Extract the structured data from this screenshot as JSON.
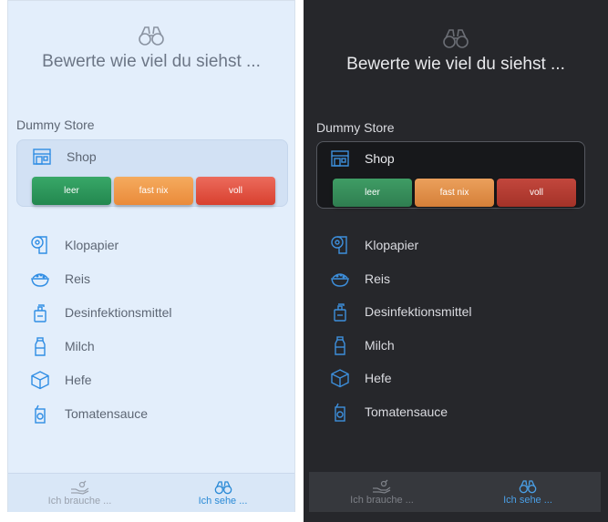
{
  "header": {
    "title": "Bewerte wie viel du siehst ...",
    "icon": "binoculars-icon"
  },
  "store": {
    "name": "Dummy Store"
  },
  "shop": {
    "label": "Shop",
    "icon": "storefront-icon",
    "ratings": [
      {
        "label": "leer",
        "color": "#2a9a5c"
      },
      {
        "label": "fast nix",
        "color": "#f09b4b"
      },
      {
        "label": "voll",
        "color": "#e04c3c"
      }
    ]
  },
  "items": [
    {
      "label": "Klopapier",
      "icon": "toilet-paper-icon"
    },
    {
      "label": "Reis",
      "icon": "rice-bowl-icon"
    },
    {
      "label": "Desinfektionsmittel",
      "icon": "disinfectant-icon"
    },
    {
      "label": "Milch",
      "icon": "milk-bottle-icon"
    },
    {
      "label": "Hefe",
      "icon": "yeast-cube-icon"
    },
    {
      "label": "Tomatensauce",
      "icon": "tomato-sauce-icon"
    }
  ],
  "tabs": [
    {
      "label": "Ich brauche ...",
      "icon": "hand-need-icon",
      "active": false
    },
    {
      "label": "Ich sehe ...",
      "icon": "binoculars-icon",
      "active": true
    }
  ],
  "colors": {
    "accent_light": "#2a8ad6",
    "accent_dark": "#4a9fe6",
    "icon_blue": "#2f8de4"
  }
}
